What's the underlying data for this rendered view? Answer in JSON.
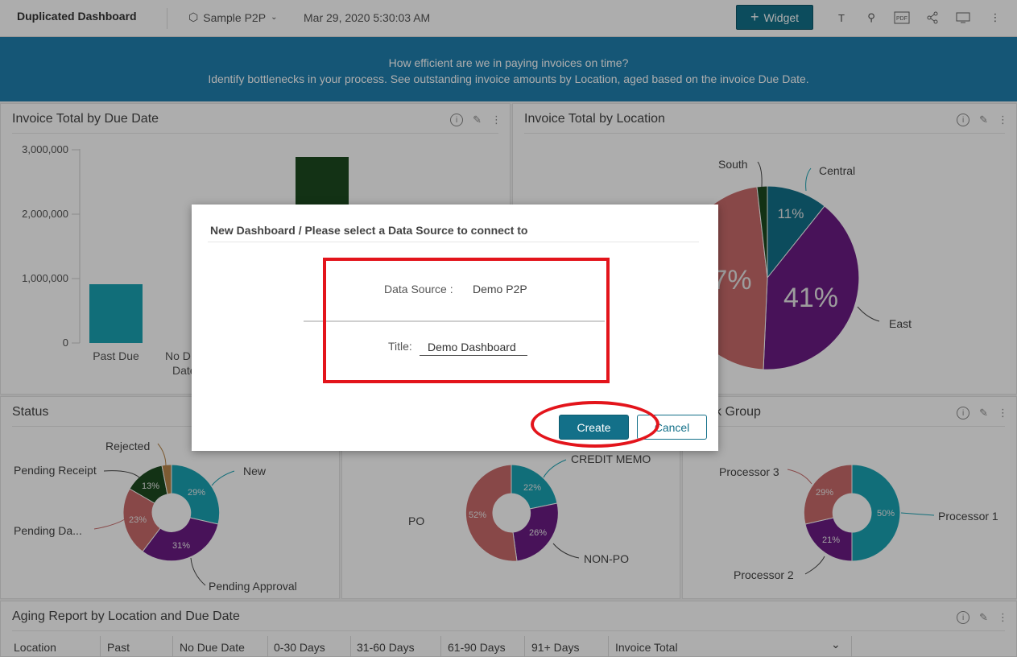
{
  "topbar": {
    "dashboard_title": "Duplicated Dashboard",
    "data_source": "Sample P2P",
    "timestamp": "Mar 29, 2020 5:30:03 AM",
    "widget_label": "Widget"
  },
  "banner": {
    "line1": "How efficient are we in paying invoices on time?",
    "line2": "Identify bottlenecks in your process.  See outstanding invoice amounts by Location, aged based on the invoice Due Date."
  },
  "panels": {
    "due_date": {
      "title": "Invoice Total by Due Date",
      "y_ticks": [
        "3,000,000",
        "2,000,000",
        "1,000,000",
        "0"
      ],
      "categories": [
        "Past Due",
        "No D",
        "Date"
      ]
    },
    "location": {
      "title": "Invoice Total by Location",
      "labels": {
        "south": "South",
        "central": "Central",
        "east": "East"
      },
      "pct": {
        "central": "11%",
        "east": "41%",
        "west_partial": "7%"
      }
    },
    "status": {
      "title": "Status",
      "labels": {
        "rejected": "Rejected",
        "pending_receipt": "Pending Receipt",
        "new": "New",
        "pending_da": "Pending Da...",
        "pending_approval": "Pending Approval"
      },
      "pct": {
        "rejected": "13%",
        "new": "29%",
        "pending_da": "23%",
        "pending_approval": "31%"
      }
    },
    "type": {
      "labels": {
        "credit_memo": "CREDIT MEMO",
        "po": "PO",
        "non_po": "NON-PO"
      },
      "pct": {
        "credit_memo": "22%",
        "po": "52%",
        "non_po": "26%"
      }
    },
    "group": {
      "title": "k Group",
      "labels": {
        "p3": "Processor 3",
        "p1": "Processor 1",
        "p2": "Processor 2"
      },
      "pct": {
        "p3": "29%",
        "p1": "50%",
        "p2": "21%"
      }
    },
    "aging": {
      "title": "Aging Report by Location and Due Date",
      "columns": [
        "Location",
        "Past",
        "No Due Date",
        "0-30 Days",
        "31-60 Days",
        "61-90 Days",
        "91+ Days",
        "Invoice Total"
      ]
    }
  },
  "dialog": {
    "title": "New Dashboard /  Please select a Data Source to connect to",
    "data_source_label": "Data Source :",
    "data_source_value": "Demo P2P",
    "title_label": "Title:",
    "title_value": "Demo Dashboard",
    "create_label": "Create",
    "cancel_label": "Cancel"
  },
  "colors": {
    "accent": "#137089",
    "banner": "#1f7fae",
    "highlight": "#e3141b",
    "teal": "#1aa3b3",
    "purple": "#6a1b83",
    "salmon": "#c96a6a",
    "darkgreen": "#1d4a20"
  }
}
